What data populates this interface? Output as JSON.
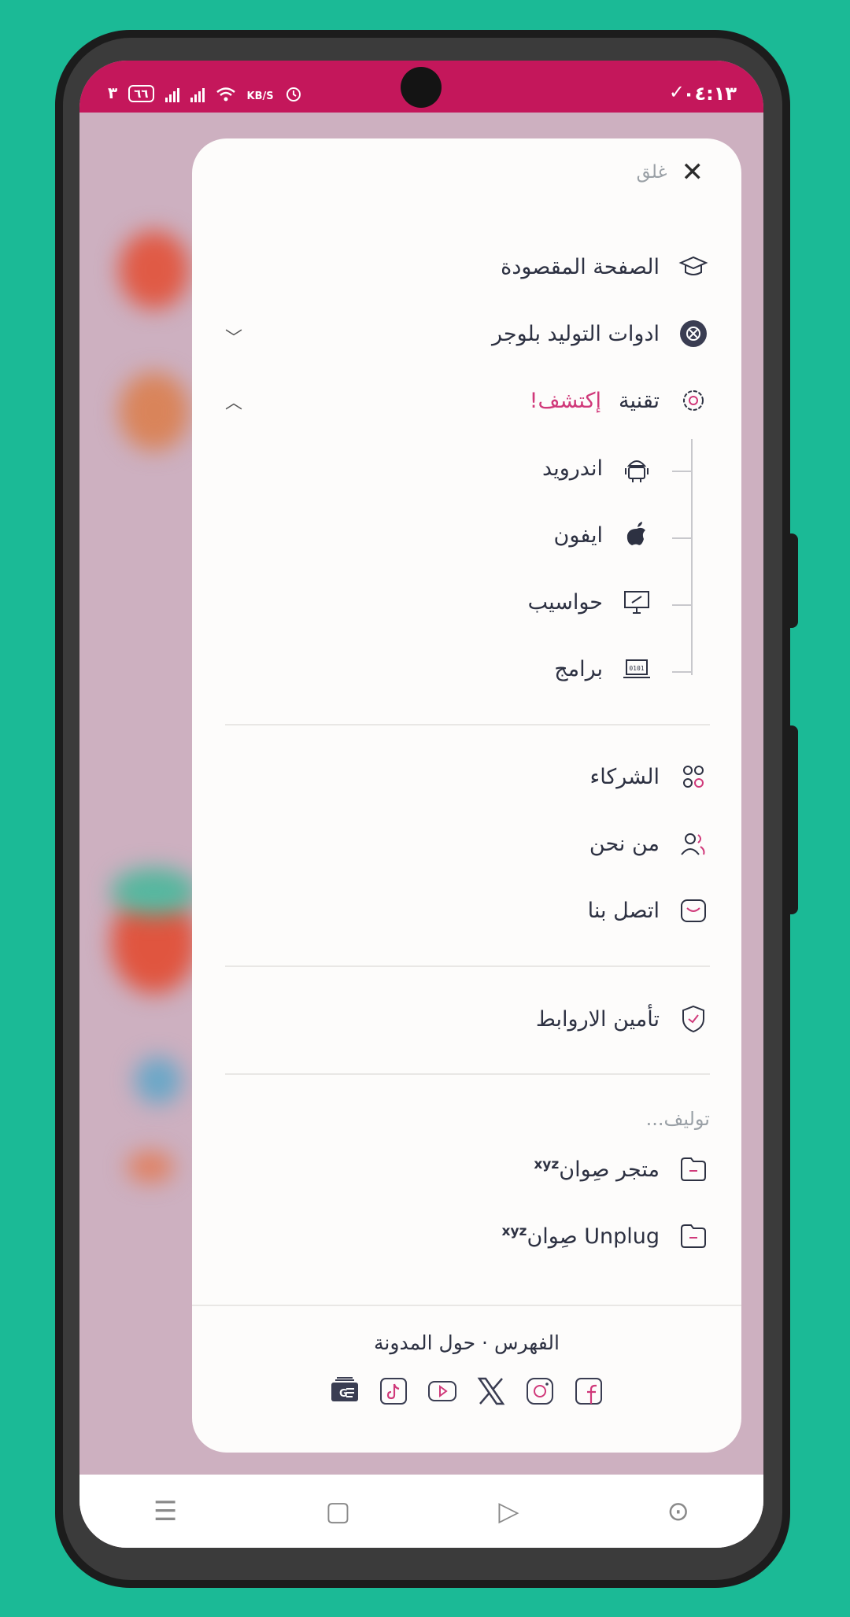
{
  "status_bar": {
    "time": "٠٤:١٣",
    "battery": "٦٦",
    "network_speed": "KB/S"
  },
  "menu": {
    "close_label": "غلق",
    "items_main": [
      {
        "label": "الصفحة المقصودة",
        "icon": "graduation-cap-icon"
      },
      {
        "label": "ادوات التوليد بلوجر",
        "icon": "tools-gear-icon"
      },
      {
        "label": "تقنية",
        "accent": "إكتشف!",
        "icon": "gear-icon"
      }
    ],
    "tech_sub": [
      {
        "label": "اندرويد",
        "icon": "android-icon"
      },
      {
        "label": "ايفون",
        "icon": "apple-icon"
      },
      {
        "label": "حواسيب",
        "icon": "monitor-icon"
      },
      {
        "label": "برامج",
        "icon": "laptop-code-icon"
      }
    ],
    "items_about": [
      {
        "label": "الشركاء",
        "icon": "partners-icon"
      },
      {
        "label": "من نحن",
        "icon": "users-icon"
      },
      {
        "label": "اتصل بنا",
        "icon": "mail-icon"
      }
    ],
    "security_item": {
      "label": "تأمين الاروابط",
      "icon": "shield-check-icon"
    },
    "section_label": "توليف...",
    "shops": [
      {
        "label": "متجر صِوان",
        "sup": "xyz",
        "icon": "folder-icon"
      },
      {
        "label": "Unplug صِوان",
        "sup": "xyz",
        "icon": "folder-icon"
      }
    ],
    "footer_links": {
      "index": "الفهرس",
      "separator": "·",
      "about": "حول المدونة"
    },
    "socials": [
      "facebook-icon",
      "instagram-icon",
      "x-icon",
      "youtube-icon",
      "tiktok-icon",
      "google-news-icon"
    ]
  },
  "colors": {
    "accent": "#d0397a",
    "status_bar": "#c4175b",
    "background": "#1bba96"
  }
}
